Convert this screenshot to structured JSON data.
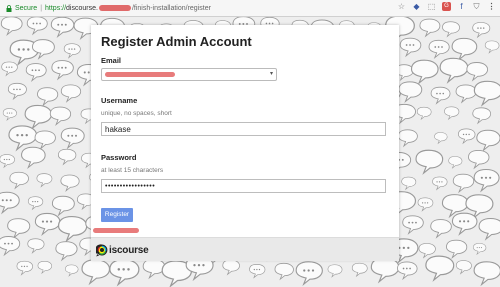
{
  "browser": {
    "secure_label": "Secure",
    "url_scheme": "https://",
    "url_host": "discourse.",
    "url_path": "/finish-installation/register",
    "extensions": [
      "star-icon",
      "puzzle-extension-icon",
      "red-extension-icon",
      "facebook-extension-icon",
      "shield-extension-icon",
      "menu-icon"
    ]
  },
  "form": {
    "title": "Register Admin Account",
    "email_label": "Email",
    "username_label": "Username",
    "username_hint": "unique, no spaces, short",
    "username_value": "hakase",
    "password_label": "Password",
    "password_hint": "at least 15 characters",
    "password_value": "•••••••••••••••••",
    "register_label": "Register"
  },
  "footer": {
    "brand": "iscourse"
  },
  "colors": {
    "accent": "#6b93e6",
    "redaction": "#e87b7b",
    "secure_green": "#1a8a2a"
  }
}
